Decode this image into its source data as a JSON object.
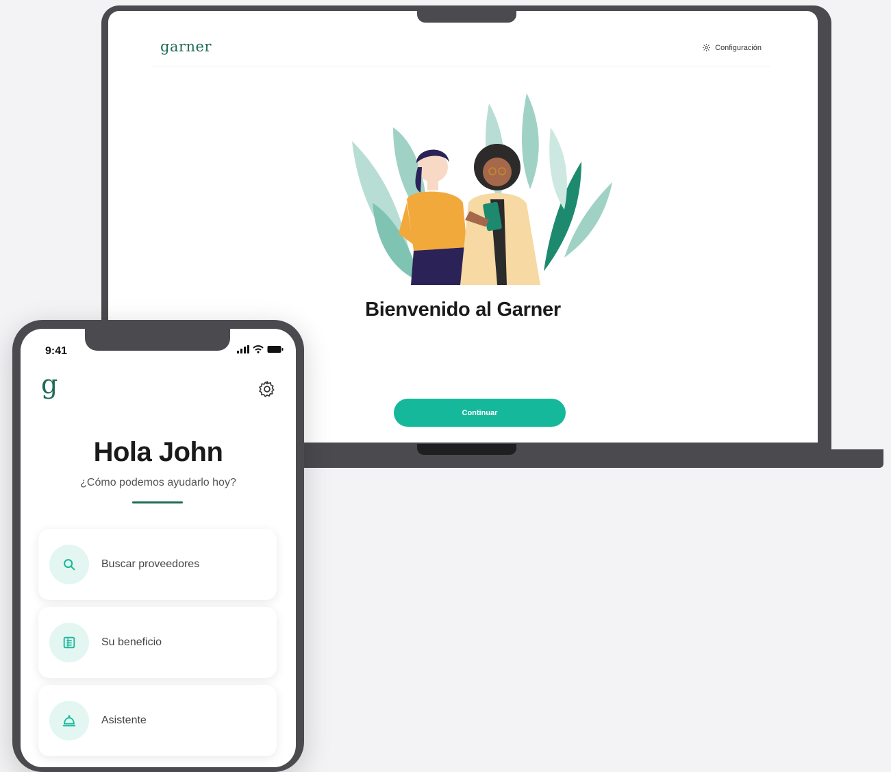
{
  "laptop": {
    "logo": "garner",
    "settings_label": "Configuración",
    "welcome_title": "Bienvenido al Garner",
    "continue_label": "Continuar"
  },
  "phone": {
    "status_time": "9:41",
    "logo": "g",
    "greeting": "Hola John",
    "subgreeting": "¿Cómo podemos ayudarlo hoy?",
    "menu": [
      {
        "label": "Buscar proveedores",
        "icon": "search-icon"
      },
      {
        "label": "Su beneficio",
        "icon": "document-icon"
      },
      {
        "label": "Asistente",
        "icon": "concierge-bell-icon"
      }
    ]
  },
  "colors": {
    "brand_green": "#1d6b57",
    "button_teal": "#16b89b",
    "icon_bg": "#e3f6f1",
    "device_frame": "#4b4b4f"
  }
}
